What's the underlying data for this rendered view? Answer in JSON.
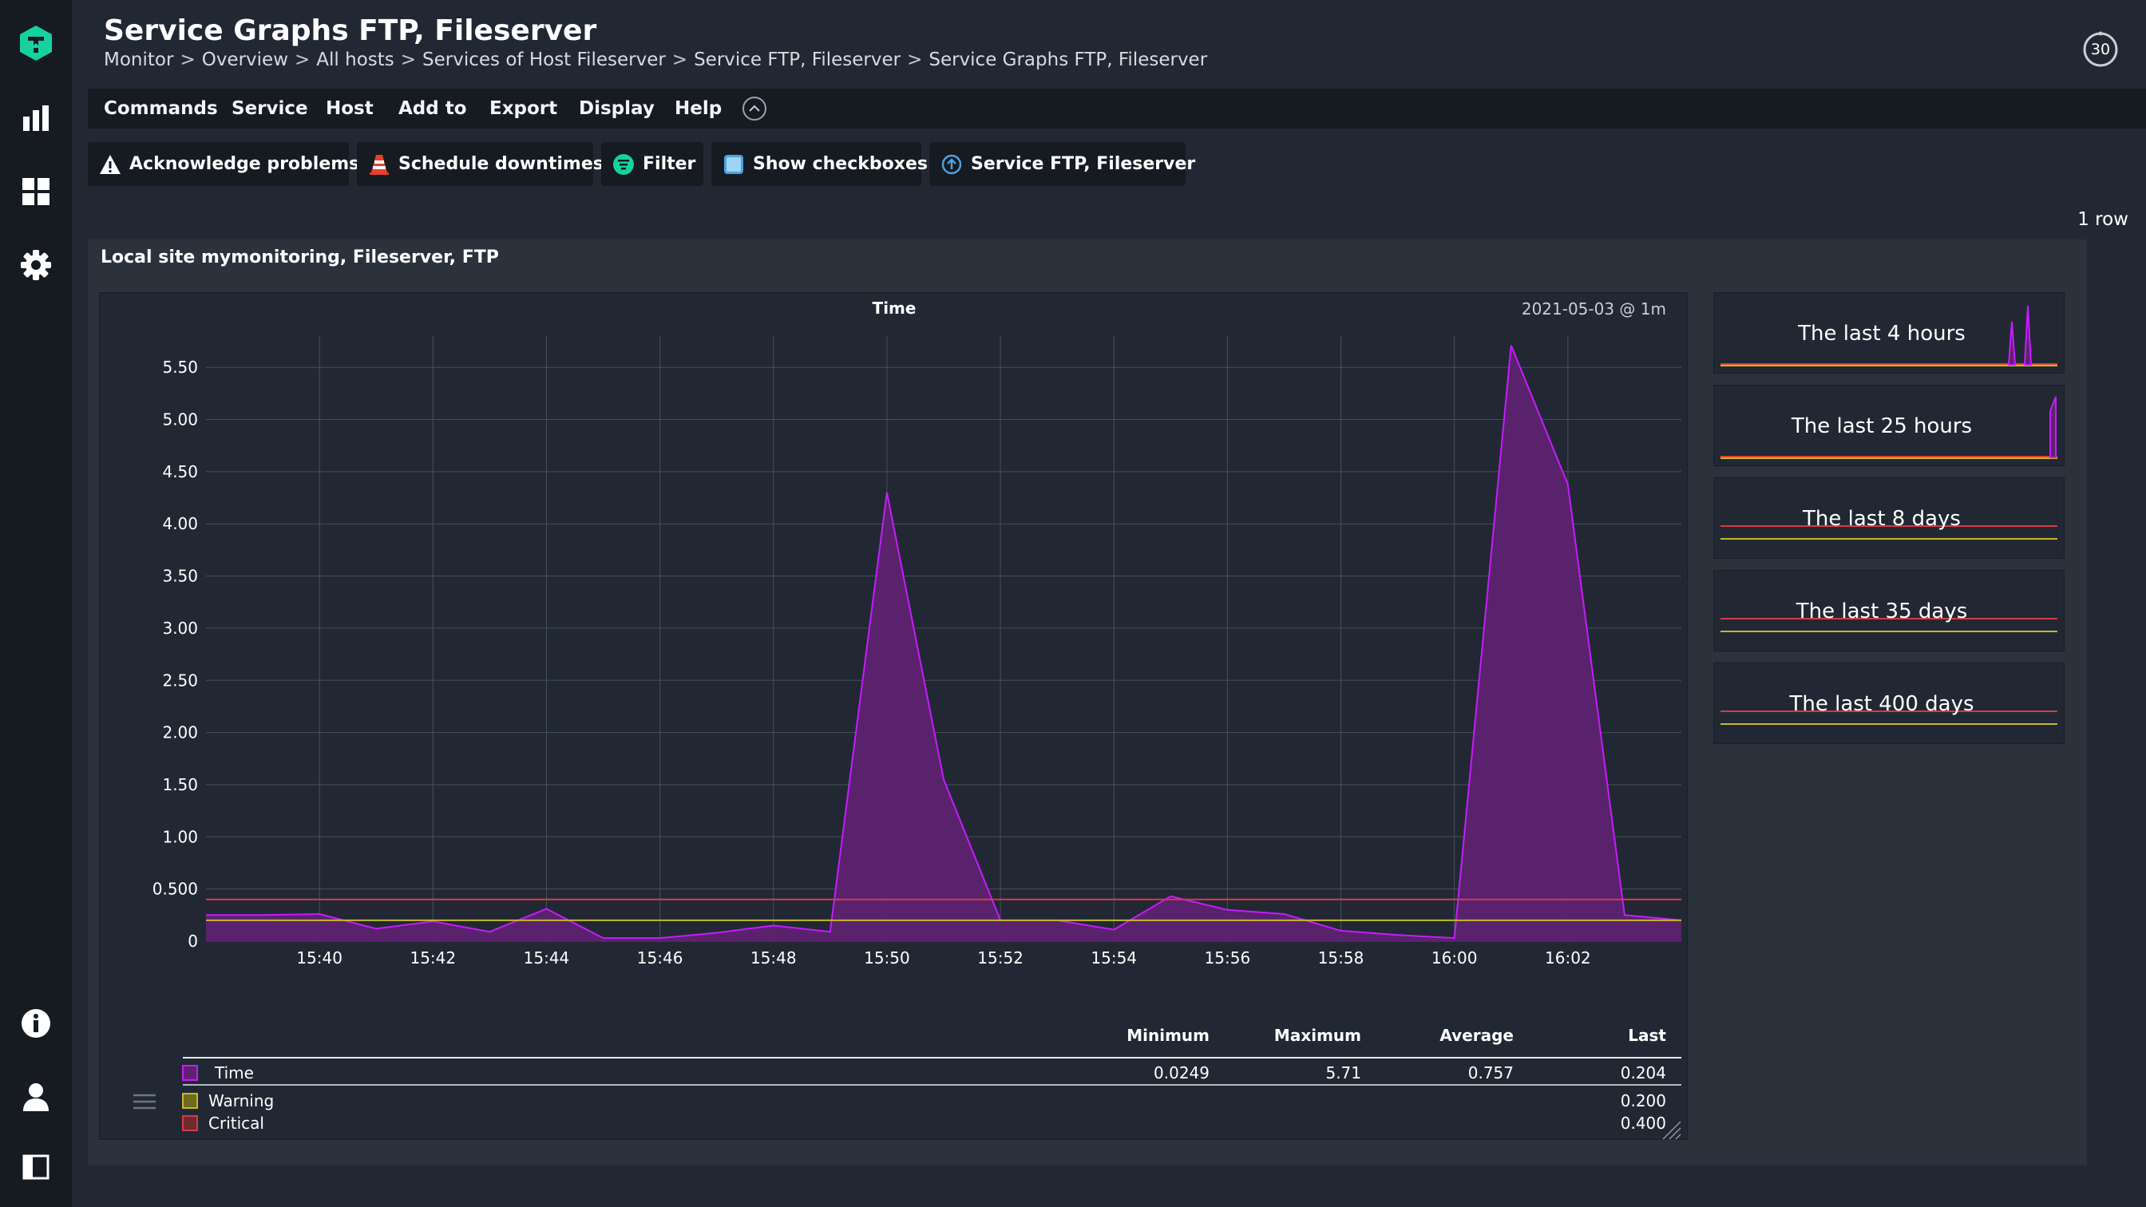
{
  "header": {
    "title": "Service Graphs FTP, Fileserver",
    "breadcrumb": [
      "Monitor",
      "Overview",
      "All hosts",
      "Services of Host Fileserver",
      "Service FTP, Fileserver",
      "Service Graphs FTP, Fileserver"
    ],
    "breadcrumb_sep": ">",
    "refresh_seconds": "30"
  },
  "sidebar": {
    "icons": [
      "checkmk-logo-icon",
      "monitor-icon",
      "dashboard-icon",
      "setup-gear-icon",
      "help-info-icon",
      "user-icon",
      "sidebar-toggle-icon"
    ]
  },
  "menubar": {
    "items": [
      "Commands",
      "Service",
      "Host",
      "Add to",
      "Export",
      "Display",
      "Help"
    ]
  },
  "shortcuts": [
    {
      "label": "Acknowledge problems",
      "icon": "warning-triangle-icon"
    },
    {
      "label": "Schedule downtimes",
      "icon": "traffic-cone-icon"
    },
    {
      "label": "Filter",
      "icon": "filter-icon"
    },
    {
      "label": "Show checkboxes",
      "icon": "checkbox-icon"
    },
    {
      "label": "Service FTP, Fileserver",
      "icon": "service-up-icon"
    }
  ],
  "row_count": "1 row",
  "panel": {
    "title": "Local site mymonitoring, Fileserver, FTP"
  },
  "graph": {
    "title": "Time",
    "timestamp": "2021-05-03 @ 1m",
    "legend_headers": [
      "Minimum",
      "Maximum",
      "Average",
      "Last"
    ],
    "legend_rows": [
      {
        "name": "Time",
        "minimum": "0.0249",
        "maximum": "5.71",
        "average": "0.757",
        "last": "0.204"
      },
      {
        "name": "Warning",
        "minimum": "",
        "maximum": "",
        "average": "",
        "last": "0.200"
      },
      {
        "name": "Critical",
        "minimum": "",
        "maximum": "",
        "average": "",
        "last": "0.400"
      }
    ]
  },
  "timeranges": [
    {
      "label": "The last 4 hours"
    },
    {
      "label": "The last 25 hours"
    },
    {
      "label": "The last 8 days"
    },
    {
      "label": "The last 35 days"
    },
    {
      "label": "The last 400 days"
    }
  ],
  "colors": {
    "series": "#c71bff",
    "series_fill": "#5e2270",
    "warning": "#c7b829",
    "critical": "#d63a4a",
    "accent": "#15d1a0"
  },
  "chart_data": {
    "type": "area",
    "title": "Time",
    "xlabel": "",
    "ylabel": "",
    "x": [
      "15:38",
      "15:39",
      "15:40",
      "15:41",
      "15:42",
      "15:43",
      "15:44",
      "15:45",
      "15:46",
      "15:47",
      "15:48",
      "15:49",
      "15:50",
      "15:51",
      "15:52",
      "15:53",
      "15:54",
      "15:55",
      "15:56",
      "15:57",
      "15:58",
      "15:59",
      "16:00",
      "16:01",
      "16:02",
      "16:03",
      "16:04"
    ],
    "x_ticks": [
      "15:40",
      "15:42",
      "15:44",
      "15:46",
      "15:48",
      "15:50",
      "15:52",
      "15:54",
      "15:56",
      "15:58",
      "16:00",
      "16:02"
    ],
    "y_ticks": [
      "0",
      "0.500",
      "1.00",
      "1.50",
      "2.00",
      "2.50",
      "3.00",
      "3.50",
      "4.00",
      "4.50",
      "5.00",
      "5.50"
    ],
    "ylim": [
      0,
      5.8
    ],
    "grid": true,
    "series": [
      {
        "name": "Time",
        "values": [
          0.25,
          0.25,
          0.26,
          0.12,
          0.19,
          0.09,
          0.31,
          0.03,
          0.03,
          0.08,
          0.15,
          0.09,
          4.3,
          1.55,
          0.2,
          0.2,
          0.11,
          0.43,
          0.3,
          0.26,
          0.1,
          0.06,
          0.03,
          5.71,
          4.38,
          0.25,
          0.2
        ]
      },
      {
        "name": "Warning",
        "values": [
          0.2
        ]
      },
      {
        "name": "Critical",
        "values": [
          0.4
        ]
      }
    ]
  }
}
